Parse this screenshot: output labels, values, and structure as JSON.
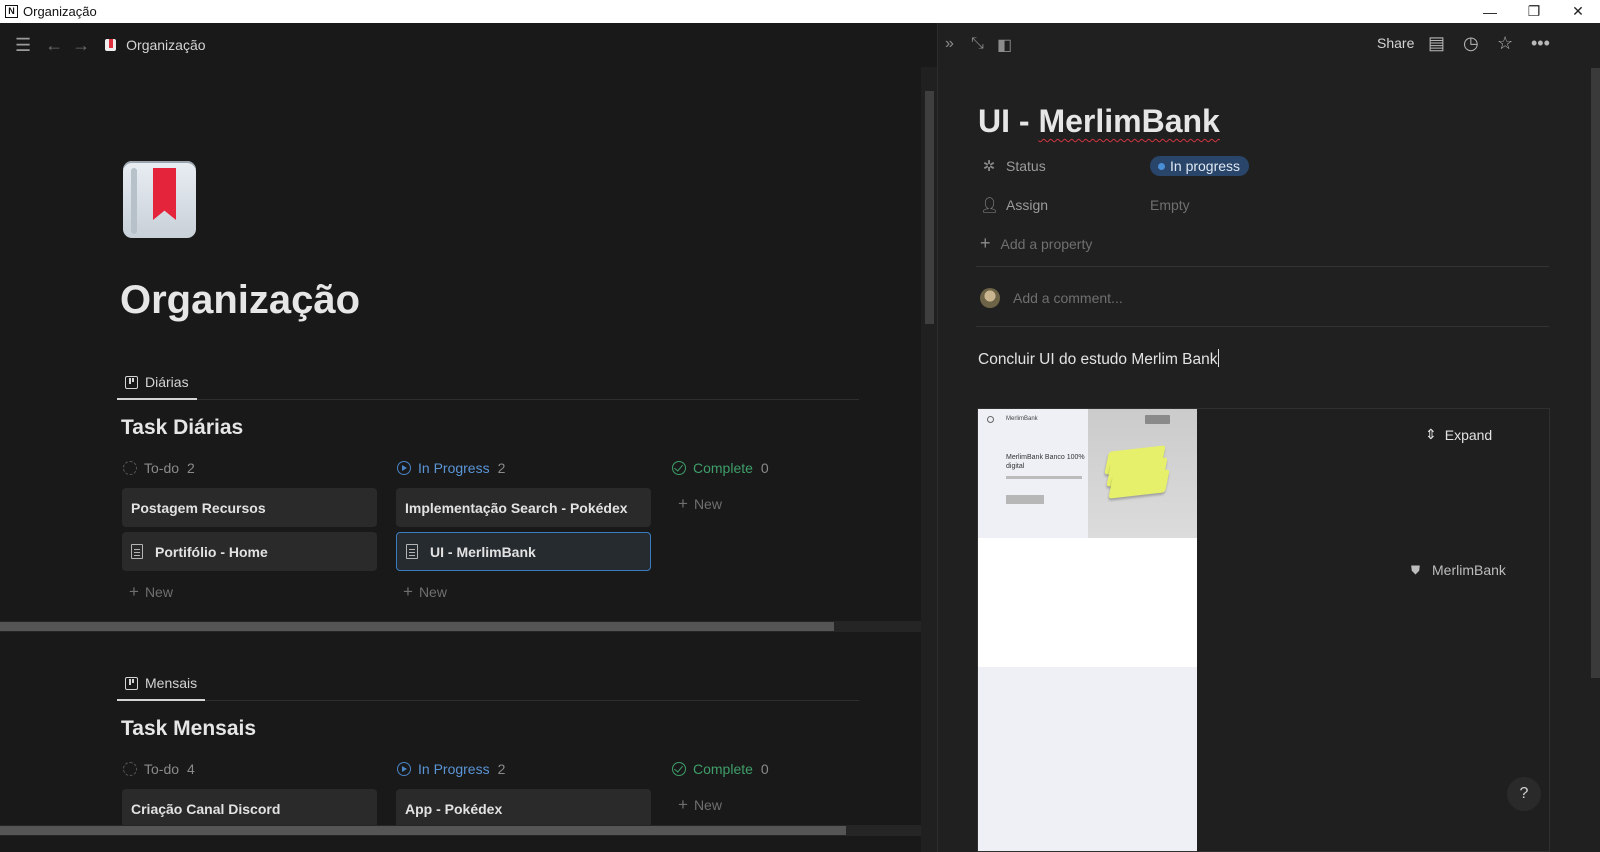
{
  "window": {
    "title": "Organização",
    "controls": {
      "minimize": "—",
      "restore": "❐",
      "close": "✕"
    }
  },
  "left_topbar": {
    "breadcrumb": "Organização"
  },
  "page": {
    "title": "Organização"
  },
  "boards": [
    {
      "view_tab": "Diárias",
      "title": "Task Diárias",
      "columns": [
        {
          "label": "To-do",
          "count": "2",
          "cards": [
            "Postagem Recursos",
            "Portifólio - Home"
          ],
          "new": "New"
        },
        {
          "label": "In Progress",
          "count": "2",
          "cards": [
            "Implementação Search - Pokédex",
            "UI - MerlimBank"
          ],
          "new": "New"
        },
        {
          "label": "Complete",
          "count": "0",
          "cards": [],
          "new": "New"
        }
      ]
    },
    {
      "view_tab": "Mensais",
      "title": "Task Mensais",
      "columns": [
        {
          "label": "To-do",
          "count": "4",
          "cards": [
            "Criação Canal Discord"
          ],
          "new": "New"
        },
        {
          "label": "In Progress",
          "count": "2",
          "cards": [
            "App - Pokédex"
          ],
          "new": "New"
        },
        {
          "label": "Complete",
          "count": "0",
          "cards": [],
          "new": "New"
        }
      ]
    }
  ],
  "right_panel": {
    "share_label": "Share",
    "doc_title_prefix": "UI - ",
    "doc_title_word": "MerlimBank",
    "properties": {
      "status_name": "Status",
      "status_value": "In progress",
      "assign_name": "Assign",
      "assign_value": "Empty",
      "add_property": "Add a property"
    },
    "comment_placeholder": "Add a comment...",
    "body_text": "Concluir UI do estudo Merlim Bank",
    "embed": {
      "expand_label": "Expand",
      "link_label": "MerlimBank",
      "preview_brand": "MerlimBank",
      "preview_login": "Login",
      "preview_headline": "MerlimBank Banco 100% digital",
      "preview_cta": "Abrir uma conta"
    },
    "help_label": "?"
  },
  "colors": {
    "background": "#191919",
    "panel": "#202020",
    "accent_blue": "#4a84c4",
    "complete_green": "#3f9e6a",
    "status_pill": "#29456a"
  }
}
